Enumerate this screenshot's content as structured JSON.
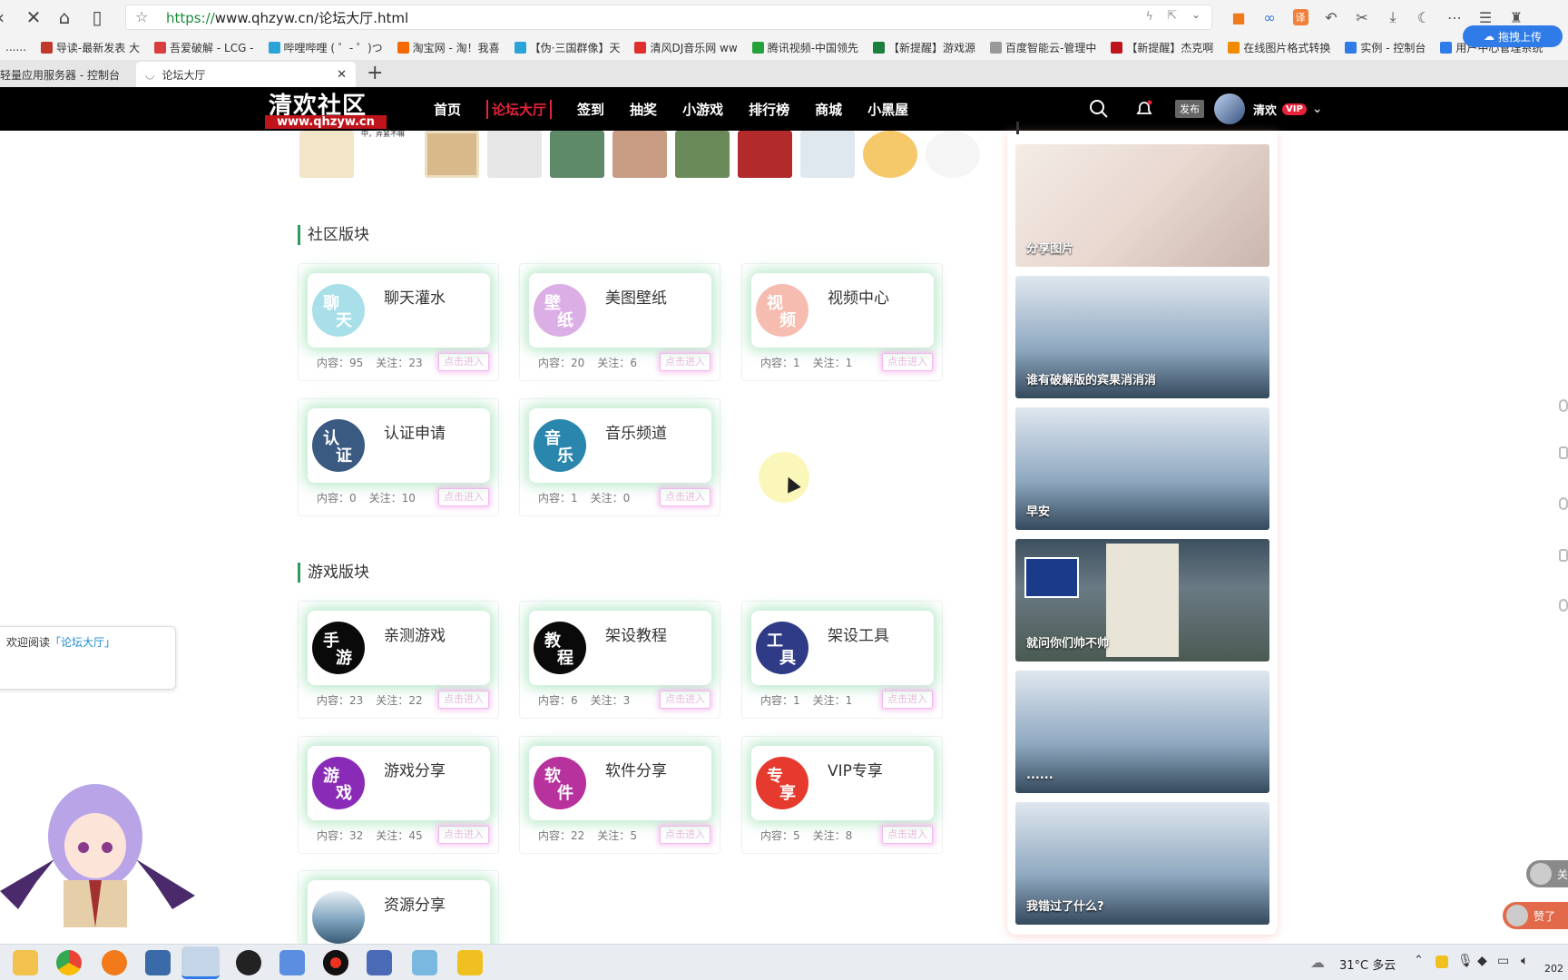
{
  "browser": {
    "url_prefix": "https://",
    "url_host": "www.qhzyw.cn",
    "url_path": "/论坛大厅.html",
    "upload_pill": "拖拽上传",
    "bookmarks": [
      {
        "label": "......",
        "color": "#888"
      },
      {
        "label": "导读-最新发表 大",
        "color": "#c0392b"
      },
      {
        "label": "吾爱破解 - LCG -",
        "color": "#d93d3d"
      },
      {
        "label": "哔哩哔哩 ( ゜- ゜)つ",
        "color": "#2aa4d8"
      },
      {
        "label": "淘宝网 - 淘！我喜",
        "color": "#f56a00"
      },
      {
        "label": "【伪·三国群像】天",
        "color": "#2aa4d8"
      },
      {
        "label": "清风DJ音乐网 ww",
        "color": "#e0302d"
      },
      {
        "label": "腾讯视频-中国领先",
        "color": "#25a13b"
      },
      {
        "label": "【新提醒】游戏源",
        "color": "#1a7f3c"
      },
      {
        "label": "百度智能云-管理中",
        "color": "#999"
      },
      {
        "label": "【新提醒】杰克啊",
        "color": "#c0141c"
      },
      {
        "label": "在线图片格式转换",
        "color": "#f08a00"
      },
      {
        "label": "实例 - 控制台",
        "color": "#2f7be8"
      },
      {
        "label": "用户中心管理系统",
        "color": "#2f7be8"
      }
    ],
    "tabs": [
      {
        "label": "轻量应用服务器 - 控制台"
      },
      {
        "label": "论坛大厅"
      }
    ]
  },
  "site": {
    "logo_text": "清欢社区",
    "logo_url": "www.qhzyw.cn",
    "nav": [
      "首页",
      "论坛大厅",
      "签到",
      "抽奖",
      "小游戏",
      "排行榜",
      "商城",
      "小黑屋"
    ],
    "nav_active": "论坛大厅",
    "publish_label": "发布",
    "username": "清欢",
    "vip_label": "VIP",
    "thumb_caption": "中，弄紧不嘛"
  },
  "sections": [
    {
      "title": "社区版块"
    },
    {
      "title": "游戏版块"
    }
  ],
  "stat_labels": {
    "content": "内容：",
    "follow": "关注：",
    "enter": "点击进入"
  },
  "boards": [
    {
      "name": "聊天灌水",
      "c1": "聊",
      "c2": "天",
      "color": "#a8dfe8",
      "content": "95",
      "follow": "23"
    },
    {
      "name": "美图壁纸",
      "c1": "壁",
      "c2": "纸",
      "color": "#dcaee6",
      "content": "20",
      "follow": "6"
    },
    {
      "name": "视频中心",
      "c1": "视",
      "c2": "频",
      "color": "#f6bcb0",
      "content": "1",
      "follow": "1"
    },
    {
      "name": "认证申请",
      "c1": "认",
      "c2": "证",
      "color": "#3a5a82",
      "content": "0",
      "follow": "10"
    },
    {
      "name": "音乐频道",
      "c1": "音",
      "c2": "乐",
      "color": "#2a86ad",
      "content": "1",
      "follow": "0"
    },
    {
      "name": "亲测游戏",
      "c1": "手",
      "c2": "游",
      "color": "#0a0a0a",
      "content": "23",
      "follow": "22"
    },
    {
      "name": "架设教程",
      "c1": "教",
      "c2": "程",
      "color": "#0a0a0a",
      "content": "6",
      "follow": "3"
    },
    {
      "name": "架设工具",
      "c1": "工",
      "c2": "具",
      "color": "#2f3b86",
      "content": "1",
      "follow": "1"
    },
    {
      "name": "游戏分享",
      "c1": "游",
      "c2": "戏",
      "color": "#8a2bb8",
      "content": "32",
      "follow": "45"
    },
    {
      "name": "软件分享",
      "c1": "软",
      "c2": "件",
      "color": "#b8329e",
      "content": "22",
      "follow": "5"
    },
    {
      "name": "VIP专享",
      "c1": "专",
      "c2": "享",
      "color": "#e63a2e",
      "content": "5",
      "follow": "8"
    },
    {
      "name": "资源分享",
      "c1": "",
      "c2": "",
      "color": "#7fa4bf",
      "content": "",
      "follow": ""
    }
  ],
  "right_pictures": [
    {
      "caption": "分享图片",
      "color": "#e8d8d0"
    },
    {
      "caption": "谁有破解版的宾果消消消",
      "color": "#8fa8c0"
    },
    {
      "caption": "早安",
      "color": "#8fa8c0"
    },
    {
      "caption": "就问你们帅不帅",
      "color": "#5a6a78"
    },
    {
      "caption": "......",
      "color": "#8fa8c0"
    },
    {
      "caption": "我错过了什么?",
      "color": "#8fa8c0"
    }
  ],
  "welcome": {
    "prefix": "欢迎阅读",
    "link": "「论坛大厅」"
  },
  "taskbar": {
    "weather": "31°C 多云",
    "year_fragment": "202"
  },
  "floating": {
    "follow": "关",
    "like": "赞了"
  }
}
